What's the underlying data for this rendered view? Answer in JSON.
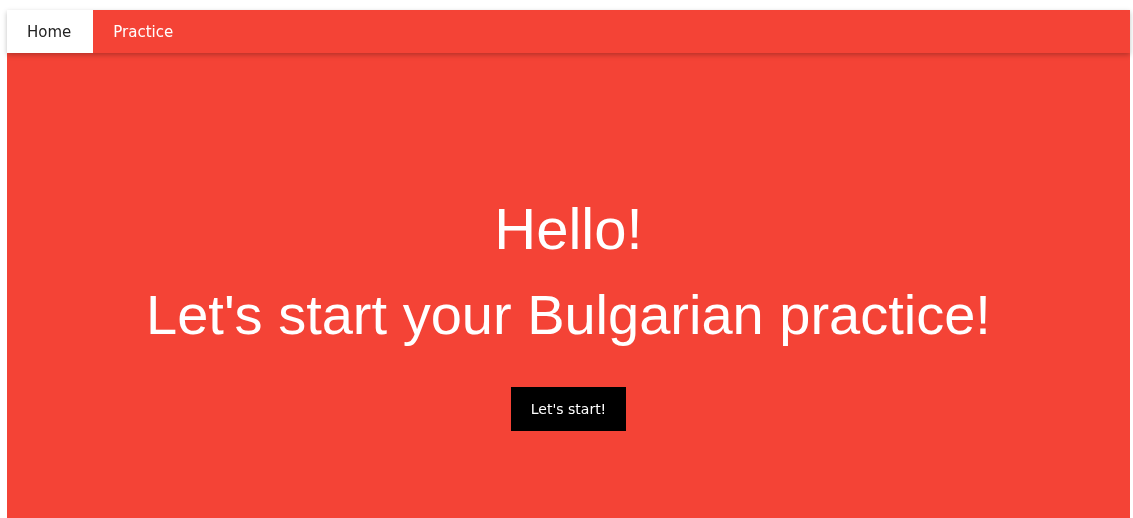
{
  "nav": {
    "tabs": [
      {
        "label": "Home",
        "selected": true
      },
      {
        "label": "Practice",
        "selected": false
      }
    ]
  },
  "hero": {
    "title": "Hello!",
    "subtitle": "Let's start your Bulgarian practice!",
    "button": "Let's start!"
  }
}
